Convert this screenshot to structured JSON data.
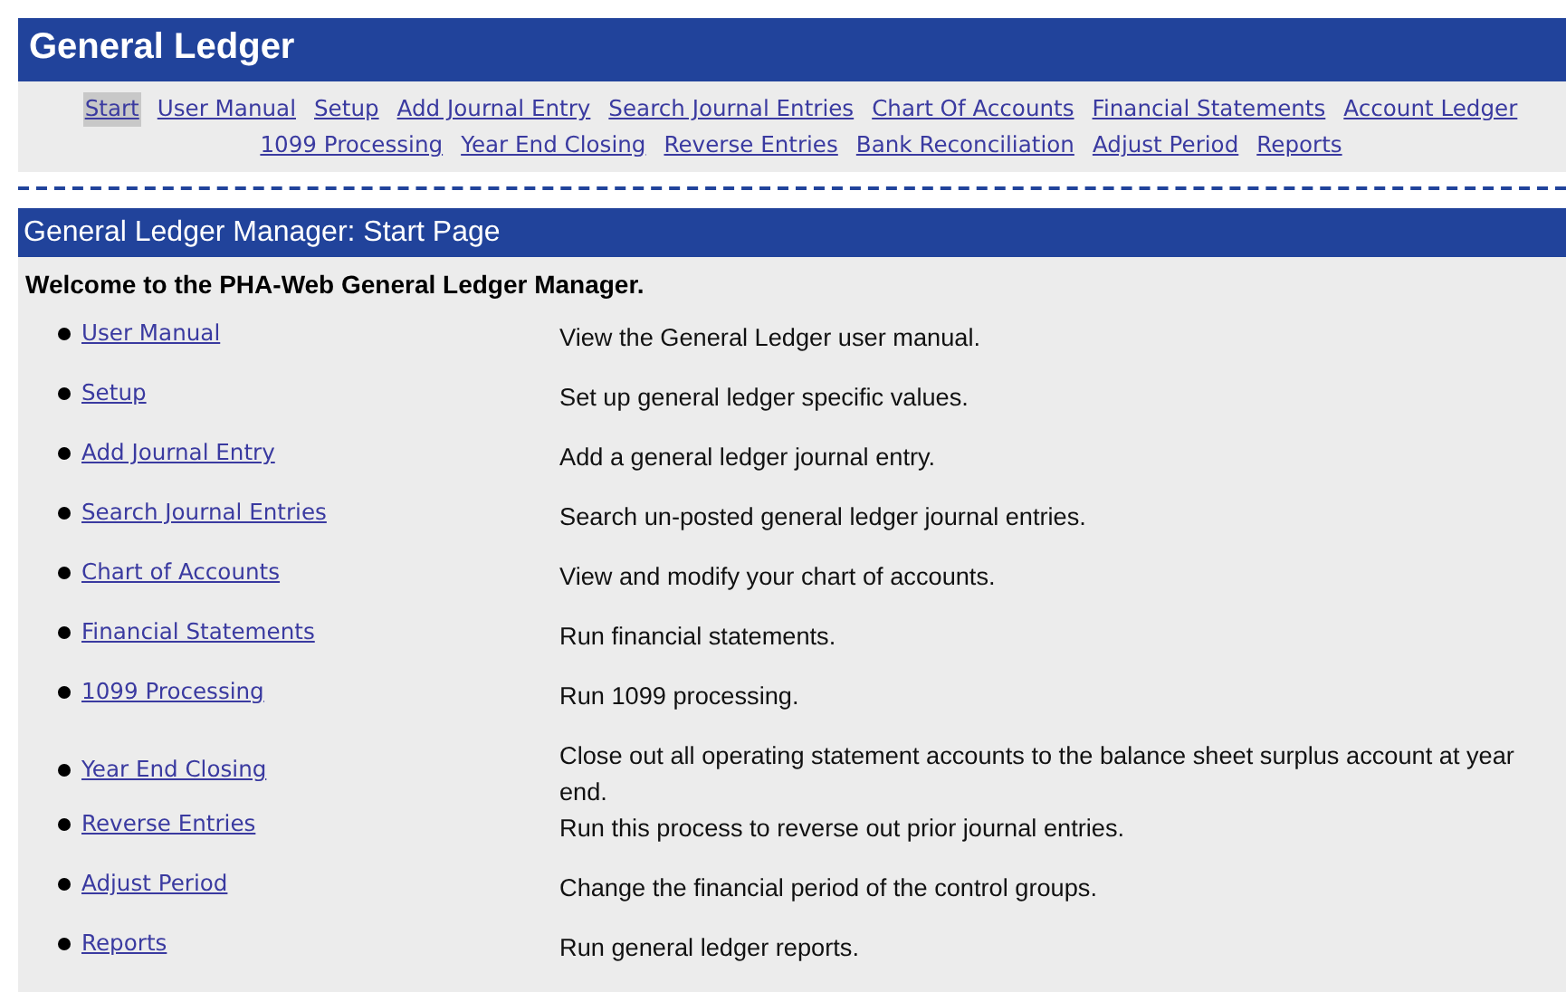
{
  "header": {
    "title": "General Ledger"
  },
  "nav": [
    {
      "label": "Start",
      "selected": true
    },
    {
      "label": "User Manual",
      "selected": false
    },
    {
      "label": "Setup",
      "selected": false
    },
    {
      "label": "Add Journal Entry",
      "selected": false
    },
    {
      "label": "Search Journal Entries",
      "selected": false
    },
    {
      "label": "Chart Of Accounts",
      "selected": false
    },
    {
      "label": "Financial Statements",
      "selected": false
    },
    {
      "label": "Account Ledger",
      "selected": false
    },
    {
      "label": "1099 Processing",
      "selected": false
    },
    {
      "label": "Year End Closing",
      "selected": false
    },
    {
      "label": "Reverse Entries",
      "selected": false
    },
    {
      "label": "Bank Reconciliation",
      "selected": false
    },
    {
      "label": "Adjust Period",
      "selected": false
    },
    {
      "label": "Reports",
      "selected": false
    }
  ],
  "section": {
    "title": "General Ledger Manager: Start Page",
    "welcome": "Welcome to the PHA-Web General Ledger Manager.",
    "items": [
      {
        "link": "User Manual",
        "description": "View the General Ledger user manual."
      },
      {
        "link": "Setup",
        "description": "Set up general ledger specific values."
      },
      {
        "link": "Add Journal Entry",
        "description": "Add a general ledger journal entry."
      },
      {
        "link": "Search Journal Entries",
        "description": "Search un-posted general ledger journal entries."
      },
      {
        "link": "Chart of Accounts",
        "description": "View and modify your chart of accounts."
      },
      {
        "link": "Financial Statements",
        "description": "Run financial statements."
      },
      {
        "link": "1099 Processing",
        "description": "Run 1099 processing."
      },
      {
        "link": "Year End Closing",
        "description": "Close out all operating statement accounts to the balance sheet surplus account at year end."
      },
      {
        "link": "Reverse Entries",
        "description": "Run this process to reverse out prior journal entries."
      },
      {
        "link": "Adjust Period",
        "description": "Change the financial period of the control groups."
      },
      {
        "link": "Reports",
        "description": "Run general ledger reports."
      }
    ]
  }
}
